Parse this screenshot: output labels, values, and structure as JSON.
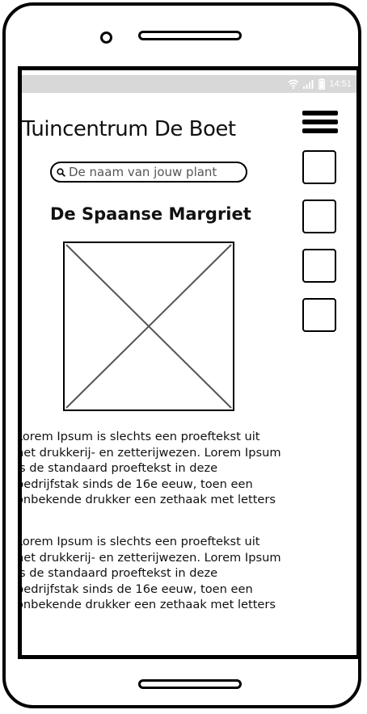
{
  "status_bar": {
    "time": "14:51",
    "icons": [
      "wifi-icon",
      "signal-icon",
      "battery-icon"
    ]
  },
  "header": {
    "title": "Tuincentrum De Boet",
    "menu_icon": "hamburger-menu-icon"
  },
  "search": {
    "placeholder": "De naam van jouw plant",
    "icon": "search-icon"
  },
  "plant": {
    "title": "De Spaanse Margriet",
    "image": "image-placeholder"
  },
  "paragraphs": [
    "Lorem Ipsum is slechts een proeftekst uit\nhet drukkerij- en zetterijwezen. Lorem Ipsum\nis de standaard proeftekst in deze\nbedrijfstak sinds de 16e eeuw, toen een\nonbekende drukker een zethaak met letters",
    "Lorem Ipsum is slechts een proeftekst uit\nhet drukkerij- en zetterijwezen. Lorem Ipsum\nis de standaard proeftekst in deze\nbedrijfstak sinds de 16e eeuw, toen een\nonbekende drukker een zethaak met letters"
  ],
  "side_buttons_count": 4,
  "colors": {
    "statusbar": "#d8d8d8",
    "outline": "#000000"
  }
}
